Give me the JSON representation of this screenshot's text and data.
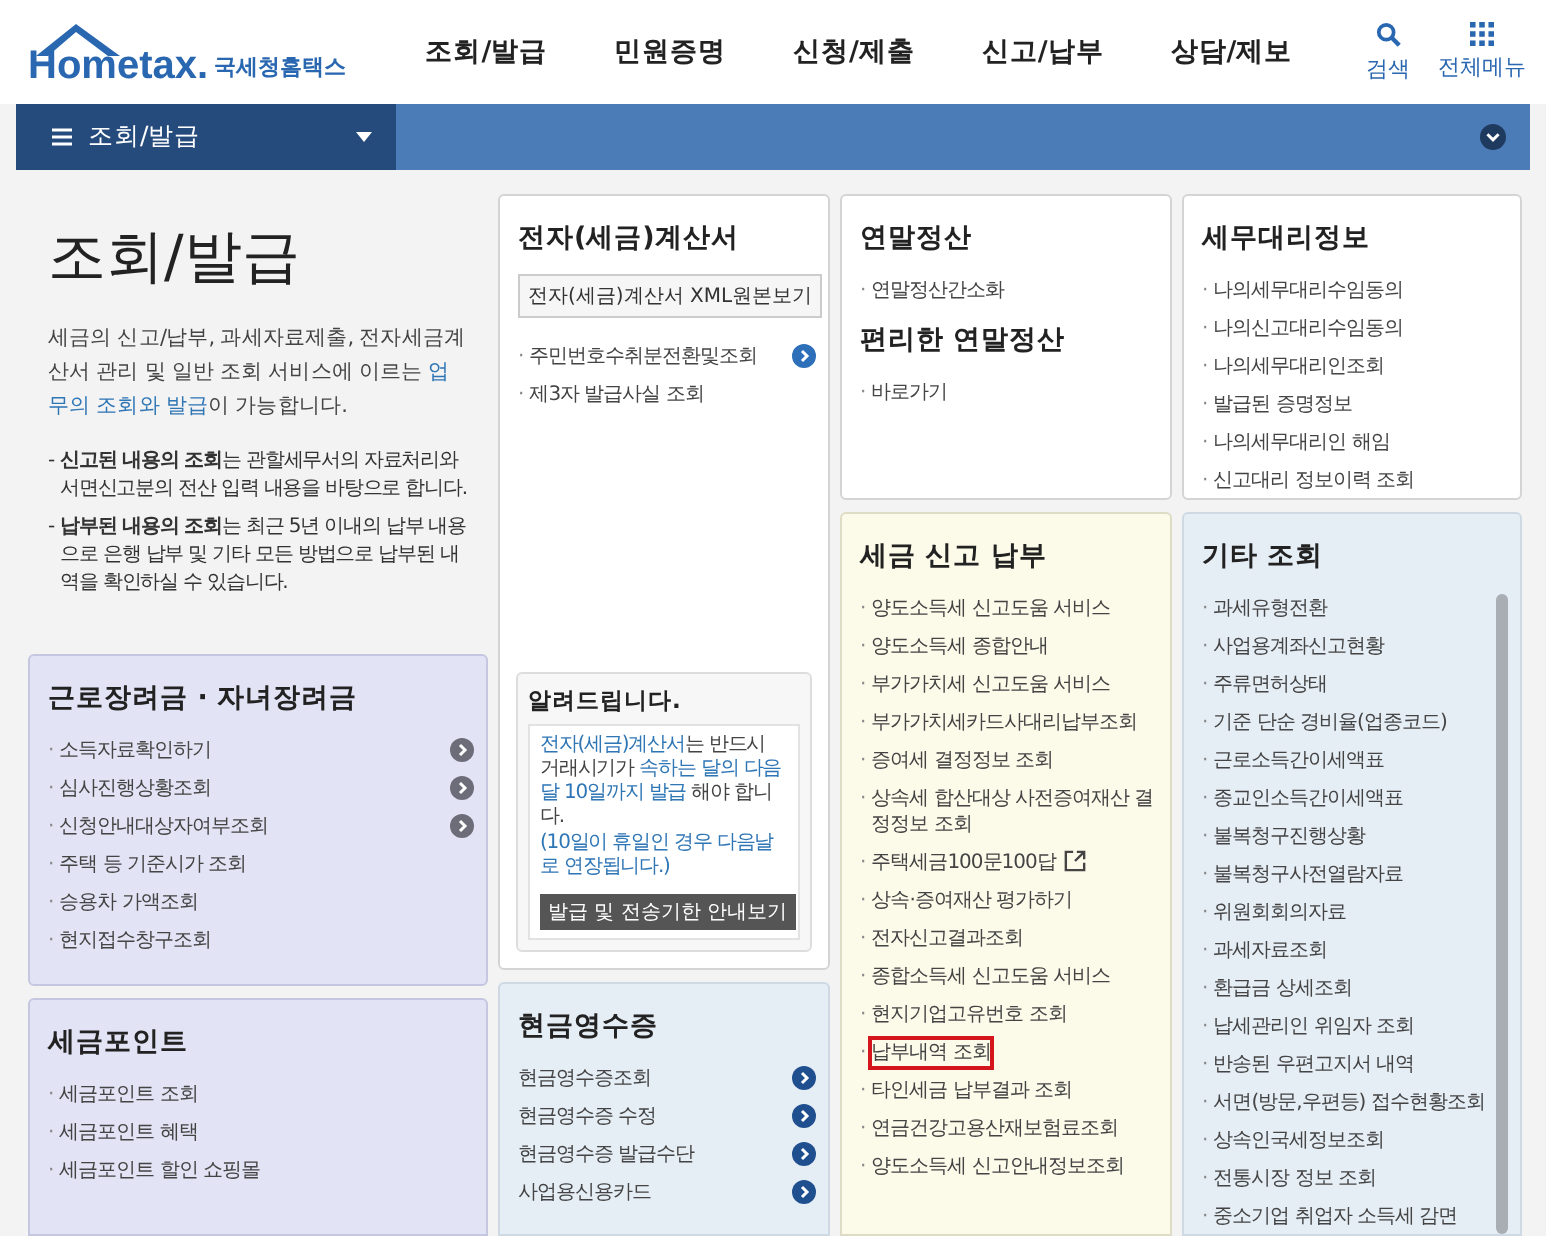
{
  "header": {
    "logo_text": "Hometax.",
    "logo_subtitle": "국세청홈택스",
    "nav": [
      "조회/발급",
      "민원증명",
      "신청/제출",
      "신고/납부",
      "상담/제보"
    ],
    "search_label": "검색",
    "menu_label": "전체메뉴"
  },
  "breadcrumb": {
    "label": "조회/발급"
  },
  "intro": {
    "title": "조회/발급",
    "description": [
      {
        "text": "세금의 신고/납부, 과세자료제출, 전자세금계산서 관리 및 일반 조회 서비스에 이르는 ",
        "emphasis": false
      },
      {
        "text": "업무의 조회와 발급",
        "emphasis": true
      },
      {
        "text": "이 가능합니다.",
        "emphasis": false
      }
    ],
    "notes": [
      {
        "marker": "-",
        "text": "**신고된 내용의 조회**는 관할세무서의 자료처리와 서면신고분의 전산 입력 내용을 바탕으로 합니다."
      },
      {
        "marker": "-",
        "text": "**납부된 내용의 조회**는 최근 5년 이내의 납부 내용으로 은행 납부 및 기타 모든 방법으로 납부된 내역을 확인하실 수 있습니다."
      }
    ]
  },
  "left_cards": [
    {
      "kind": "lavender",
      "bullet": "·",
      "sections": [
        {
          "title": "근로장려금 · 자녀장려금",
          "items": [
            {
              "label": "소득자료확인하기",
              "arrow": true
            },
            {
              "label": "심사진행상황조회",
              "arrow": true
            },
            {
              "label": "신청안내대상자여부조회",
              "arrow": true
            },
            {
              "label": "주택 등 기준시가 조회",
              "arrow": false
            },
            {
              "label": "승용차 가액조회",
              "arrow": false
            },
            {
              "label": "현지접수창구조회",
              "arrow": false
            }
          ]
        }
      ]
    },
    {
      "kind": "lavender",
      "bullet": "·",
      "sections": [
        {
          "title": "세금포인트",
          "items": [
            {
              "label": "세금포인트 조회",
              "arrow": false
            },
            {
              "label": "세금포인트 혜택",
              "arrow": false
            },
            {
              "label": "세금포인트 할인 쇼핑몰",
              "arrow": false
            }
          ]
        }
      ]
    }
  ],
  "columns": [
    [
      {
        "kind": "white",
        "bullet": "·",
        "sections": [
          {
            "title": "전자(세금)계산서",
            "button": "전자(세금)계산서 XML원본보기",
            "items": [
              {
                "label": "주민번호수취분전환및조회",
                "arrow": true
              },
              {
                "label": "제3자 발급사실 조회",
                "arrow": false
              }
            ]
          }
        ],
        "notice": {
          "title": "알려드립니다.",
          "parts": [
            {
              "text": "전자(세금)계산서",
              "emphasis": true
            },
            {
              "text": "는 반드시 거래시기가 ",
              "emphasis": false
            },
            {
              "text": "속하는 달의 다음 달 10일까지 발급",
              "emphasis": true
            },
            {
              "text": " 해야 합니다.",
              "emphasis": false
            }
          ],
          "footnote": "(10일이 휴일인 경우 다음날로 연장됩니다.)",
          "button": "발급 및 전송기한 안내보기"
        }
      },
      {
        "kind": "blue",
        "sections": [
          {
            "title": "현금영수증",
            "items": [
              {
                "label": "현금영수증조회",
                "arrow": true
              },
              {
                "label": "현금영수증 수정",
                "arrow": true
              },
              {
                "label": "현금영수증 발급수단",
                "arrow": true
              },
              {
                "label": "사업용신용카드",
                "arrow": true
              }
            ]
          }
        ]
      }
    ],
    [
      {
        "kind": "white",
        "bullet": "·",
        "sections": [
          {
            "title": "연말정산",
            "items": [
              {
                "label": "연말정산간소화",
                "arrow": false
              }
            ]
          },
          {
            "title": "편리한 연말정산",
            "items": [
              {
                "label": "바로가기",
                "arrow": false
              }
            ]
          }
        ]
      },
      {
        "kind": "cream",
        "bullet": "·",
        "sections": [
          {
            "title": "세금 신고 납부",
            "items": [
              {
                "label": "양도소득세 신고도움 서비스",
                "highlighted": false,
                "external": false
              },
              {
                "label": "양도소득세 종합안내",
                "highlighted": false,
                "external": false
              },
              {
                "label": "부가가치세 신고도움 서비스",
                "highlighted": false,
                "external": false
              },
              {
                "label": "부가가치세카드사대리납부조회",
                "highlighted": false,
                "external": false
              },
              {
                "label": "증여세 결정정보 조회",
                "highlighted": false,
                "external": false
              },
              {
                "label": "상속세 합산대상 사전증여재산 결정정보 조회",
                "highlighted": false,
                "external": false
              },
              {
                "label": "주택세금100문100답",
                "highlighted": false,
                "external": true
              },
              {
                "label": "상속·증여재산 평가하기",
                "highlighted": false,
                "external": false
              },
              {
                "label": "전자신고결과조회",
                "highlighted": false,
                "external": false
              },
              {
                "label": "종합소득세 신고도움 서비스",
                "highlighted": false,
                "external": false
              },
              {
                "label": "현지기업고유번호 조회",
                "highlighted": false,
                "external": false
              },
              {
                "label": "납부내역 조회",
                "highlighted": true,
                "external": false
              },
              {
                "label": "타인세금 납부결과 조회",
                "highlighted": false,
                "external": false
              },
              {
                "label": "연금건강고용산재보험료조회",
                "highlighted": false,
                "external": false
              },
              {
                "label": "양도소득세 신고안내정보조회",
                "highlighted": false,
                "external": false
              }
            ]
          }
        ]
      }
    ],
    [
      {
        "kind": "white",
        "bullet": "·",
        "sections": [
          {
            "title": "세무대리정보",
            "items": [
              {
                "label": "나의세무대리수임동의"
              },
              {
                "label": "나의신고대리수임동의"
              },
              {
                "label": "나의세무대리인조회"
              },
              {
                "label": "발급된 증명정보"
              },
              {
                "label": "나의세무대리인 해임"
              },
              {
                "label": "신고대리 정보이력 조회"
              }
            ]
          }
        ]
      },
      {
        "kind": "blue",
        "bullet": "·",
        "scrollbar": true,
        "sections": [
          {
            "title": "기타 조회",
            "items": [
              {
                "label": "과세유형전환"
              },
              {
                "label": "사업용계좌신고현황"
              },
              {
                "label": "주류면허상태"
              },
              {
                "label": "기준 단순 경비율(업종코드)"
              },
              {
                "label": "근로소득간이세액표"
              },
              {
                "label": "종교인소득간이세액표"
              },
              {
                "label": "불복청구진행상황"
              },
              {
                "label": "불복청구사전열람자료"
              },
              {
                "label": "위원회회의자료"
              },
              {
                "label": "과세자료조회"
              },
              {
                "label": "환급금 상세조회"
              },
              {
                "label": "납세관리인 위임자 조회"
              },
              {
                "label": "반송된 우편고지서 내역"
              },
              {
                "label": "서면(방문,우편등) 접수현황조회"
              },
              {
                "label": "상속인국세정보조회"
              },
              {
                "label": "전통시장 정보 조회"
              },
              {
                "label": "중소기업 취업자 소득세 감면"
              }
            ]
          }
        ]
      }
    ]
  ]
}
